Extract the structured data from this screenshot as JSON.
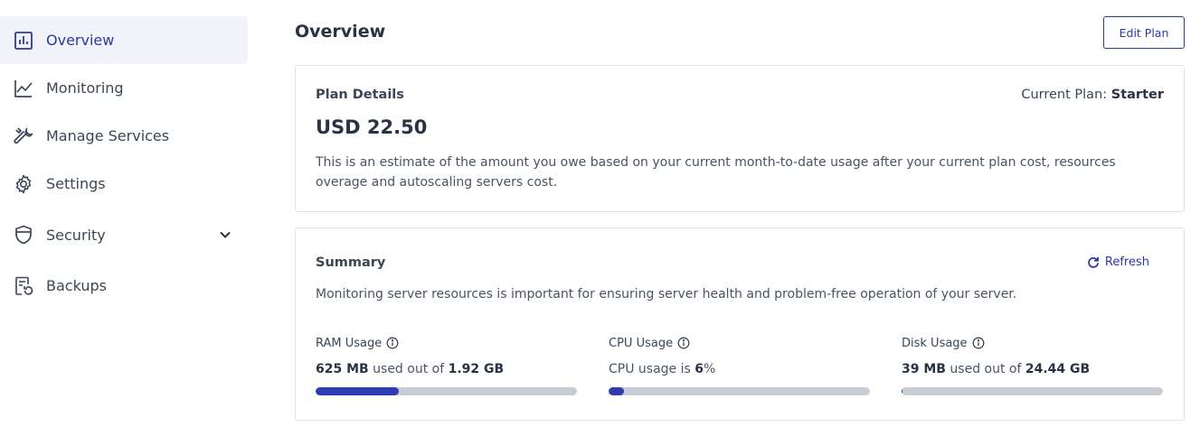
{
  "sidebar": {
    "items": [
      {
        "label": "Overview",
        "icon": "chart-icon",
        "active": true
      },
      {
        "label": "Monitoring",
        "icon": "line-chart-icon"
      },
      {
        "label": "Manage Services",
        "icon": "wrench-icon"
      },
      {
        "label": "Settings",
        "icon": "gear-icon"
      },
      {
        "label": "Security",
        "icon": "shield-icon",
        "expandable": true
      },
      {
        "label": "Backups",
        "icon": "backup-icon"
      }
    ]
  },
  "header": {
    "title": "Overview",
    "edit_plan_label": "Edit Plan"
  },
  "plan": {
    "heading": "Plan Details",
    "current_plan_label": "Current Plan:",
    "current_plan_value": "Starter",
    "price": "USD 22.50",
    "description": "This is an estimate of the amount you owe based on your current month-to-date usage after your current plan cost, resources overage and autoscaling servers cost."
  },
  "summary": {
    "heading": "Summary",
    "refresh_label": "Refresh",
    "description": "Monitoring server resources is important for ensuring server health and problem-free operation of your server.",
    "metrics": [
      {
        "label": "RAM Usage",
        "used": "625 MB",
        "middle": "used out of",
        "total": "1.92 GB",
        "fraction": 0.32
      },
      {
        "label": "CPU Usage",
        "prefix": "CPU usage is",
        "value": "6",
        "suffix": "%",
        "fraction": 0.06
      },
      {
        "label": "Disk Usage",
        "used": "39 MB",
        "middle": "used out of",
        "total": "24.44 GB",
        "fraction": 0.0016
      }
    ]
  },
  "colors": {
    "accent": "#2b3a9f",
    "bar_fill": "#2e3db2",
    "bar_track": "#c8ccd4"
  }
}
